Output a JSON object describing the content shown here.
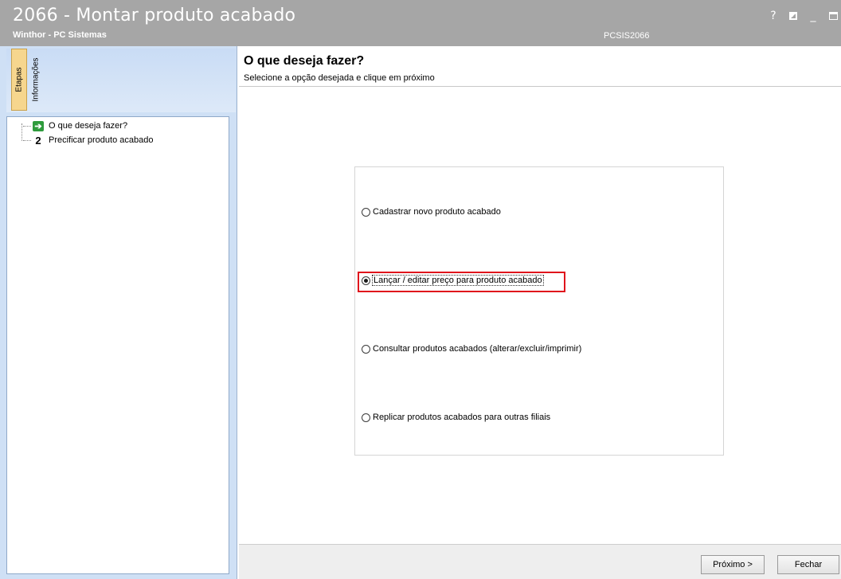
{
  "window": {
    "title": "2066 - Montar produto acabado",
    "subtitle": "Winthor - PC Sistemas",
    "code": "PCSIS2066",
    "buttons": {
      "help": "?",
      "minimize": "_"
    }
  },
  "left_panel": {
    "tabs": [
      "Etapas",
      "Informações"
    ],
    "active_tab": "Etapas",
    "steps": [
      {
        "marker": "➔",
        "label": "O que deseja fazer?",
        "current": true
      },
      {
        "marker": "2",
        "label": "Precificar produto acabado",
        "current": false
      }
    ]
  },
  "main": {
    "title": "O que deseja fazer?",
    "subtitle": "Selecione a opção desejada e clique em próximo",
    "options": [
      {
        "label": "Cadastrar novo produto acabado",
        "checked": false
      },
      {
        "label": "Lançar / editar preço para produto acabado",
        "checked": true
      },
      {
        "label": "Consultar produtos acabados (alterar/excluir/imprimir)",
        "checked": false
      },
      {
        "label": "Replicar produtos acabados para outras filiais",
        "checked": false
      }
    ]
  },
  "footer": {
    "next_label": "Próximo >",
    "close_label": "Fechar"
  },
  "colors": {
    "titlebar": "#a6a6a6",
    "left_panel": "#cfe0f5",
    "active_tab": "#f6d68e",
    "highlight": "#e0141c",
    "step_arrow": "#2e9b3c"
  }
}
